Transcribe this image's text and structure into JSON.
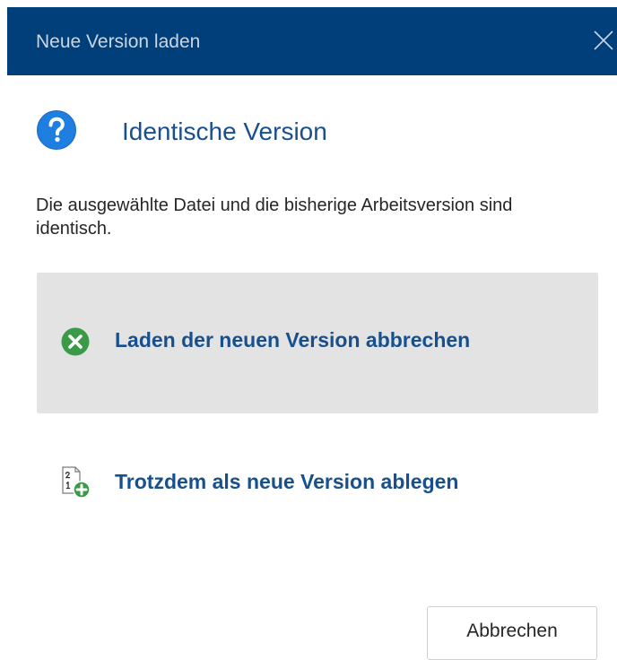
{
  "window": {
    "title": "Neue Version laden",
    "titlebar_color": "#003f7a",
    "close_icon": "close-icon"
  },
  "header": {
    "icon": "question-icon",
    "icon_color": "#1e7fe0",
    "text": "Identische Version"
  },
  "message": "Die ausgewählte Datei und die bisherige Arbeitsversion sind identisch.",
  "options": [
    {
      "icon": "cancel-circle-icon",
      "icon_color": "#3a9a48",
      "label": "Laden der neuen Version abbrechen",
      "selected": true
    },
    {
      "icon": "new-version-icon",
      "icon_color": "#3a9a48",
      "label": "Trotzdem als neue Version ablegen",
      "selected": false
    }
  ],
  "footer": {
    "cancel_label": "Abbrechen"
  },
  "colors": {
    "accent_text": "#17508c",
    "selected_background": "#e3e3e3"
  }
}
